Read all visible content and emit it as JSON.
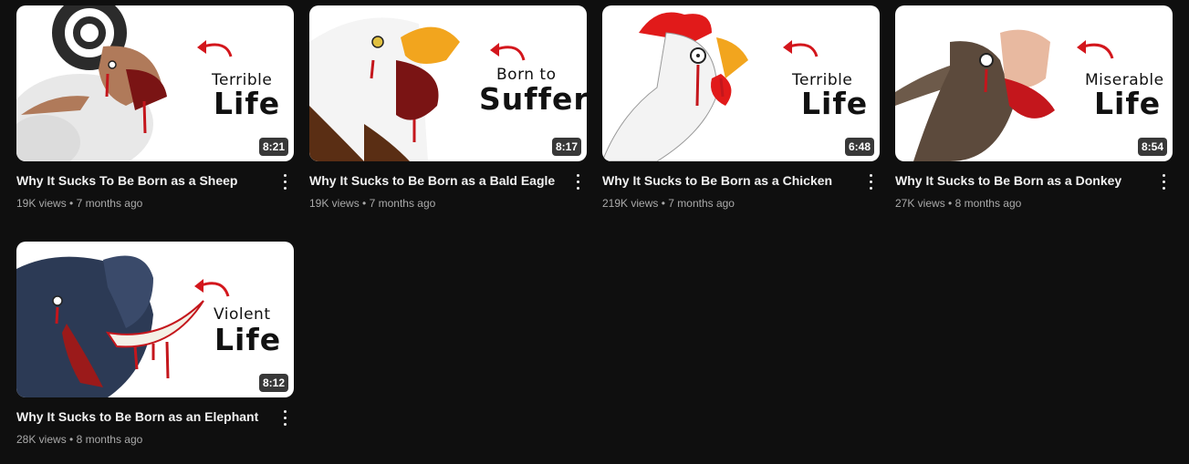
{
  "videos": [
    {
      "title": "Why It Sucks To Be Born as a Sheep",
      "views": "19K views",
      "age": "7 months ago",
      "duration": "8:21",
      "thumb_small": "Terrible",
      "thumb_big": "Life"
    },
    {
      "title": "Why It Sucks to Be Born as a Bald Eagle",
      "views": "19K views",
      "age": "7 months ago",
      "duration": "8:17",
      "thumb_small": "Born to",
      "thumb_big": "Suffer"
    },
    {
      "title": "Why It Sucks to Be Born as a Chicken",
      "views": "219K views",
      "age": "7 months ago",
      "duration": "6:48",
      "thumb_small": "Terrible",
      "thumb_big": "Life"
    },
    {
      "title": "Why It Sucks to Be Born as a Donkey",
      "views": "27K views",
      "age": "8 months ago",
      "duration": "8:54",
      "thumb_small": "Miserable",
      "thumb_big": "Life"
    },
    {
      "title": "Why It Sucks to Be Born as an Elephant",
      "views": "28K views",
      "age": "8 months ago",
      "duration": "8:12",
      "thumb_small": "Violent",
      "thumb_big": "Life"
    }
  ],
  "separator": "•",
  "icons": {
    "more": "more-vert-icon",
    "arrow": "red-curved-arrow-icon"
  },
  "colors": {
    "background": "#0f0f0f",
    "title": "#f1f1f1",
    "meta": "#aaaaaa",
    "blood": "#c4161c"
  }
}
